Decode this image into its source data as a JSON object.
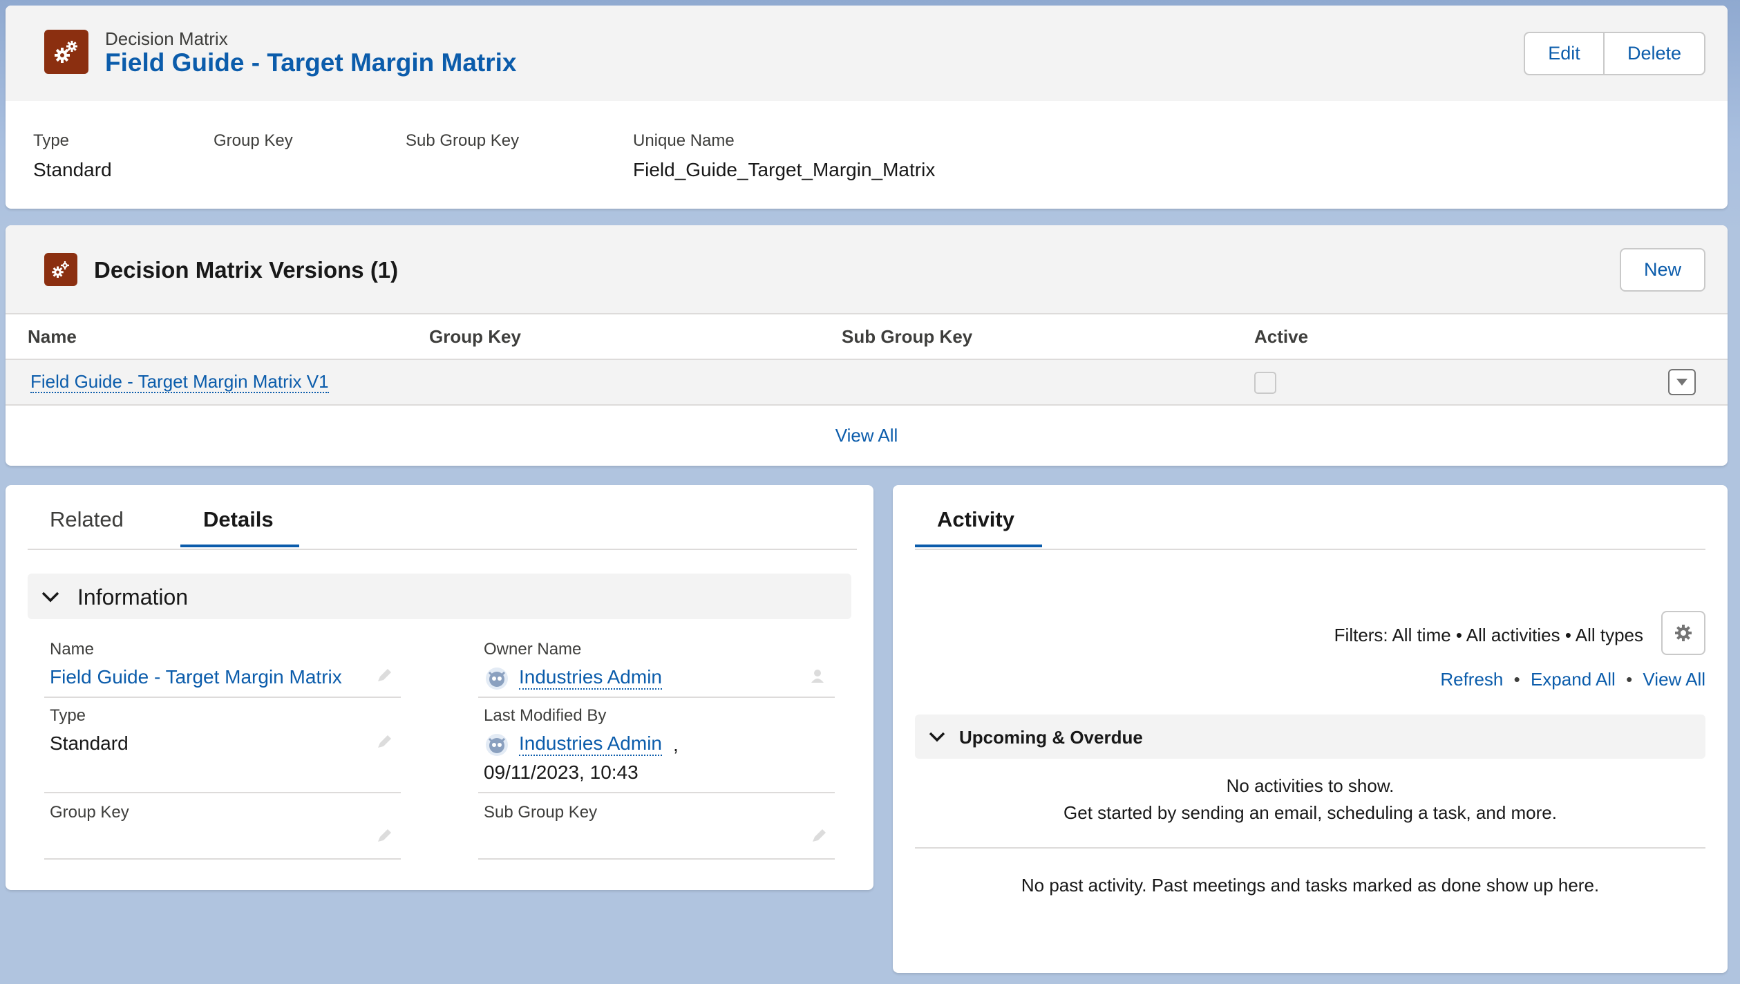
{
  "record": {
    "object_label": "Decision Matrix",
    "title": "Field Guide - Target Margin Matrix",
    "edit_label": "Edit",
    "delete_label": "Delete",
    "highlights": [
      {
        "label": "Type",
        "value": "Standard"
      },
      {
        "label": "Group Key",
        "value": ""
      },
      {
        "label": "Sub Group Key",
        "value": ""
      },
      {
        "label": "Unique Name",
        "value": "Field_Guide_Target_Margin_Matrix"
      }
    ]
  },
  "versions": {
    "title": "Decision Matrix Versions (1)",
    "new_label": "New",
    "columns": [
      "Name",
      "Group Key",
      "Sub Group Key",
      "Active"
    ],
    "rows": [
      {
        "name": "Field Guide - Target Margin Matrix V1",
        "group_key": "",
        "sub_group_key": "",
        "active": false
      }
    ],
    "view_all_label": "View All"
  },
  "details": {
    "tabs": [
      {
        "label": "Related",
        "active": false
      },
      {
        "label": "Details",
        "active": true
      }
    ],
    "section_title": "Information",
    "fields": {
      "name_label": "Name",
      "name_value": "Field Guide - Target Margin Matrix",
      "owner_label": "Owner Name",
      "owner_value": "Industries Admin",
      "type_label": "Type",
      "type_value": "Standard",
      "modified_label": "Last Modified By",
      "modified_user": "Industries Admin",
      "modified_sep": ",",
      "modified_date": "09/11/2023, 10:43",
      "group_key_label": "Group Key",
      "group_key_value": "",
      "sub_group_key_label": "Sub Group Key",
      "sub_group_key_value": ""
    }
  },
  "activity": {
    "tab_label": "Activity",
    "filters_text": "Filters: All time • All activities • All types",
    "refresh_label": "Refresh",
    "expand_all_label": "Expand All",
    "view_all_label": "View All",
    "dot": "•",
    "upcoming_title": "Upcoming & Overdue",
    "no_activities": "No activities to show.",
    "get_started": "Get started by sending an email, scheduling a task, and more.",
    "no_past": "No past activity. Past meetings and tasks marked as done show up here."
  },
  "icons": {
    "object": "gears-icon",
    "section_toggle": "chevron-down-icon",
    "row_menu": "caret-down-icon",
    "settings": "gear-icon",
    "edit": "pencil-icon",
    "avatar": "user-avatar-icon"
  },
  "colors": {
    "brand_link": "#0b5cab",
    "object_icon_bg": "#8b2f10",
    "page_bg": "#b0c4df",
    "header_bg": "#f3f3f3"
  }
}
